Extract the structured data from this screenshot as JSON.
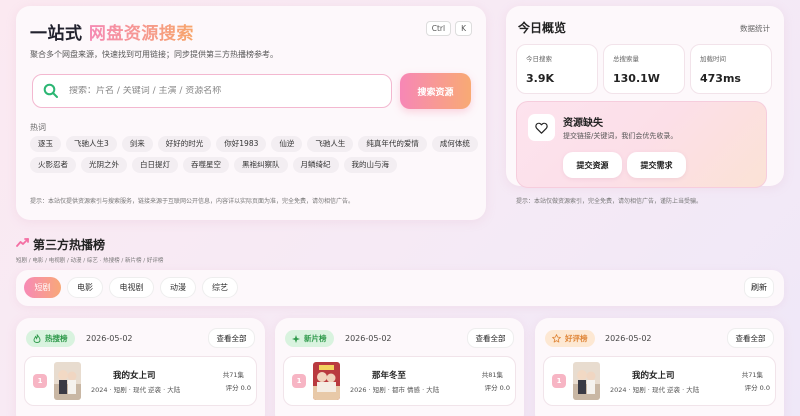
{
  "search": {
    "title_prefix": "一站式",
    "title_highlight": "网盘资源搜索",
    "kbd_ctrl": "Ctrl",
    "kbd_k": "K",
    "subtitle": "聚合多个网盘来源，快速找到可用链接；同步提供第三方热播榜参考。",
    "placeholder": "搜索：片名 / 关键词 / 主演 / 资源名称",
    "button_label": "搜索资源",
    "hot_label": "热词",
    "hot_words": [
      "逐玉",
      "飞驰人生3",
      "剑来",
      "好好的时光",
      "你好1983",
      "仙逆",
      "飞驰人生",
      "纯真年代的爱情",
      "成何体统",
      "火影忍者",
      "光阴之外",
      "白日提灯",
      "吞噬星空",
      "黑袍纠察队",
      "月鳞绮纪",
      "我的山与海"
    ],
    "notice": "提示：本站仅提供资源索引与搜索服务，链接来源于互联网公开信息，内容详以实际页面为准，完全免费，请勿相信广告。"
  },
  "overview": {
    "title": "今日概览",
    "link": "数据统计",
    "stats": [
      {
        "label": "今日搜索",
        "value": "3.9K"
      },
      {
        "label": "总搜索量",
        "value": "130.1W"
      },
      {
        "label": "加载时间",
        "value": "473ms"
      }
    ],
    "missing_title": "资源缺失",
    "missing_desc": "提交链接/关键词，我们会优先收录。",
    "submit_resource": "提交资源",
    "submit_request": "提交需求",
    "notice": "提示：本站仅做资源索引，完全免费，请勿相信广告，谨防上当受骗。"
  },
  "hot": {
    "title": "第三方热播榜",
    "subtitle": "短剧 / 电影 / 电视剧 / 动漫 / 综艺 · 热搜榜 / 新片榜 / 好评榜",
    "tabs": [
      "短剧",
      "电影",
      "电视剧",
      "动漫",
      "综艺"
    ],
    "active_tab": 0,
    "refresh": "刷新",
    "view_all": "查看全部",
    "cards": [
      {
        "badge": "热搜榜",
        "badge_icon": "flame-icon",
        "badge_bg": "#d9f3df",
        "badge_color": "#2f9a4b",
        "date": "2026-05-02",
        "item": {
          "rank": "1",
          "title": "我的女上司",
          "meta": "2024 · 短剧 · 现代 逆袭 · 大陆",
          "count": "共71集",
          "score": "评分 0.0"
        }
      },
      {
        "badge": "新片榜",
        "badge_icon": "sparkle-icon",
        "badge_bg": "#d9f3df",
        "badge_color": "#2f9a4b",
        "date": "2026-05-02",
        "item": {
          "rank": "1",
          "title": "那年冬至",
          "meta": "2026 · 短剧 · 都市 情感 · 大陆",
          "count": "共81集",
          "score": "评分 0.0"
        }
      },
      {
        "badge": "好评榜",
        "badge_icon": "star-icon",
        "badge_bg": "#fde8d3",
        "badge_color": "#e0873a",
        "date": "2026-05-02",
        "item": {
          "rank": "1",
          "title": "我的女上司",
          "meta": "2024 · 短剧 · 现代 逆袭 · 大陆",
          "count": "共71集",
          "score": "评分 0.0"
        }
      }
    ]
  },
  "colors": {
    "accent_pink": "#f787b6",
    "accent_orange": "#f8aa74",
    "search_icon": "#2bb673"
  }
}
